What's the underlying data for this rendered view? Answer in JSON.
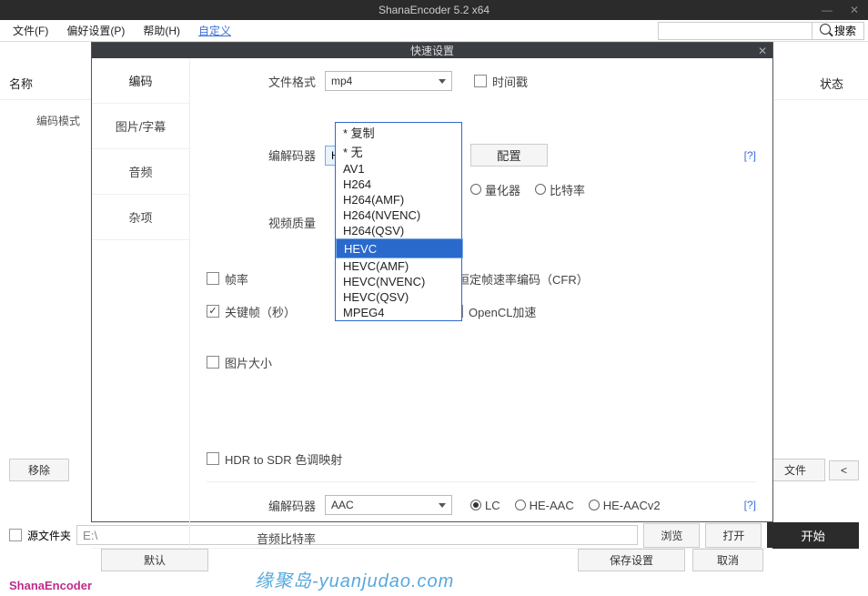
{
  "titlebar": {
    "title": "ShanaEncoder 5.2 x64"
  },
  "menubar": {
    "file": "文件(F)",
    "pref": "偏好设置(P)",
    "help": "帮助(H)",
    "custom": "自定义",
    "search": "搜索"
  },
  "main": {
    "encmode": "编码模式",
    "name_hdr": "名称",
    "state_hdr": "状态",
    "remove": "移除",
    "file_btn": "文件",
    "lt_btn": "<"
  },
  "src": {
    "label": "源文件夹",
    "path": "E:\\",
    "browse": "浏览",
    "open": "打开",
    "start": "开始"
  },
  "brand": "ShanaEncoder",
  "watermark": "缘聚岛-yuanjudao.com",
  "modal": {
    "title": "快速设置",
    "tabs": {
      "encode": "编码",
      "sub": "图片/字幕",
      "audio": "音频",
      "misc": "杂项"
    },
    "fileformat_label": "文件格式",
    "fileformat_value": "mp4",
    "timestamp": "时间戳",
    "codec_label": "编解码器",
    "codec_value": "H264",
    "config": "配置",
    "help": "[?]",
    "quantizer": "量化器",
    "bitrate": "比特率",
    "vq_label": "视频质量",
    "fps": "帧率",
    "keyframe": "关键帧（秒）",
    "cfr": "恒定帧速率编码（CFR）",
    "opencl": "OpenCL加速",
    "picsize": "图片大小",
    "hdrsdr": "HDR to SDR 色调映射",
    "audio_codec_label": "编解码器",
    "audio_codec_value": "AAC",
    "lc": "LC",
    "heaac": "HE-AAC",
    "heaacv2": "HE-AACv2",
    "abr_label": "音频比特率",
    "default_btn": "默认",
    "save_btn": "保存设置",
    "cancel_btn": "取消"
  },
  "dropdown": {
    "options": [
      "* 复制",
      "* 无",
      "AV1",
      "H264",
      "H264(AMF)",
      "H264(NVENC)",
      "H264(QSV)",
      "HEVC",
      "HEVC(AMF)",
      "HEVC(NVENC)",
      "HEVC(QSV)",
      "MPEG4"
    ],
    "selected": "HEVC"
  }
}
